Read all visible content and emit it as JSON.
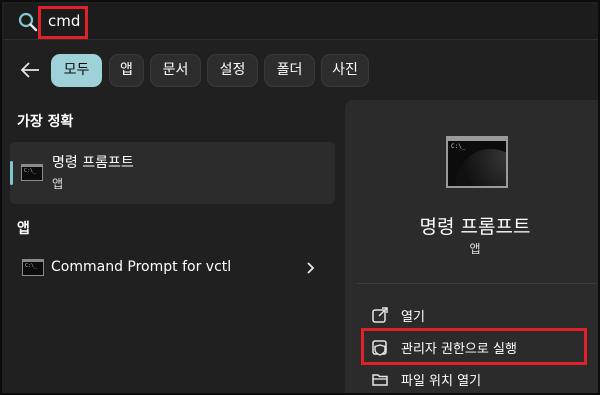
{
  "search": {
    "value": "cmd"
  },
  "filters": [
    {
      "label": "모두",
      "active": true
    },
    {
      "label": "앱",
      "active": false
    },
    {
      "label": "문서",
      "active": false
    },
    {
      "label": "설정",
      "active": false
    },
    {
      "label": "폴더",
      "active": false
    },
    {
      "label": "사진",
      "active": false
    }
  ],
  "best_match": {
    "heading": "가장 정확",
    "title": "명령 프롬프트",
    "subtitle": "앱"
  },
  "apps": {
    "heading": "앱",
    "items": [
      {
        "label": "Command Prompt for vctl"
      }
    ]
  },
  "detail": {
    "title": "명령 프롬프트",
    "subtitle": "앱",
    "actions": [
      {
        "label": "열기",
        "icon": "open-external-icon"
      },
      {
        "label": "관리자 권한으로 실행",
        "icon": "shield-admin-icon"
      },
      {
        "label": "파일 위치 열기",
        "icon": "folder-icon"
      }
    ]
  },
  "colors": {
    "accent": "#9fd1d8",
    "highlight": "#e0202a",
    "background": "#202020",
    "panel": "#2b2b2b"
  }
}
